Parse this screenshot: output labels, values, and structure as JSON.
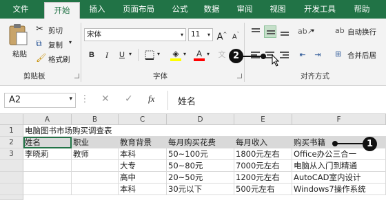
{
  "tabs": [
    {
      "label": "文件",
      "active": false
    },
    {
      "label": "开始",
      "active": true
    },
    {
      "label": "插入",
      "active": false
    },
    {
      "label": "页面布局",
      "active": false
    },
    {
      "label": "公式",
      "active": false
    },
    {
      "label": "数据",
      "active": false
    },
    {
      "label": "审阅",
      "active": false
    },
    {
      "label": "视图",
      "active": false
    },
    {
      "label": "开发工具",
      "active": false
    },
    {
      "label": "帮助",
      "active": false
    }
  ],
  "clipboard": {
    "paste": "粘贴",
    "cut": "剪切",
    "copy": "复制",
    "format_painter": "格式刷",
    "group_label": "剪贴板"
  },
  "font": {
    "name": "宋体",
    "size": "11",
    "grow": "A",
    "shrink": "A",
    "bold": "B",
    "italic": "I",
    "underline": "U",
    "font_color_letter": "A",
    "group_label": "字体"
  },
  "alignment": {
    "wrap_text": "自动换行",
    "merge_center": "合并后居",
    "group_label": "对齐方式"
  },
  "formula_bar": {
    "name_box": "A2",
    "fx": "fx",
    "content": "姓名"
  },
  "grid": {
    "columns": [
      "A",
      "B",
      "C",
      "D",
      "E",
      "F"
    ],
    "rows": [
      "1",
      "2",
      "3",
      "",
      "",
      "",
      ""
    ],
    "title": "电脑图书市场购买调查表",
    "headers": [
      "姓名",
      "职业",
      "教育背景",
      "每月购买花费",
      "每月收入",
      "购买书籍"
    ],
    "data": [
      [
        "李晓莉",
        "教师",
        "本科",
        "50~100元",
        "1800元左右",
        "Office办公三合一"
      ],
      [
        "",
        "",
        "大专",
        "50~80元",
        "7000元左右",
        "电脑从入门到精通"
      ],
      [
        "",
        "",
        "高中",
        "20~50元",
        "1200元左右",
        "AutoCAD室内设计"
      ],
      [
        "",
        "",
        "本科",
        "30元以下",
        "500元左右",
        "Windows7操作系统"
      ]
    ]
  },
  "callouts": [
    "1",
    "2"
  ],
  "colors": {
    "ribbon_green": "#217346",
    "header_fill": "#d9d9d9",
    "selected_button": "#c5dfc9"
  }
}
